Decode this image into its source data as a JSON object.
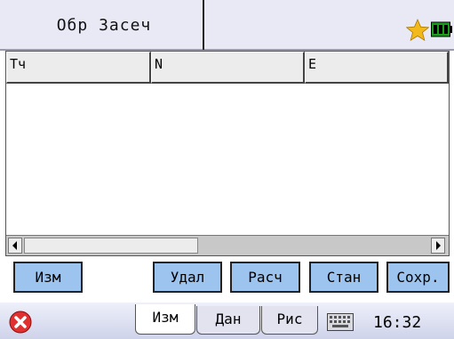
{
  "titlebar": {
    "title": "Обр Засеч",
    "icons": [
      "star-icon",
      "battery-icon"
    ],
    "colors": {
      "background": "#e9e9f6",
      "star": "#f3b81a",
      "battery": "#1c9c1c"
    }
  },
  "grid": {
    "columns": [
      "Тч",
      "N",
      "E"
    ],
    "rows": []
  },
  "buttons": {
    "measure": "Изм",
    "delete": "Удал",
    "calc": "Расч",
    "station": "Стан",
    "save": "Сохр.",
    "color": "#9cc4ef"
  },
  "bottom": {
    "tabs": [
      "Изм",
      "Дан",
      "Рис"
    ],
    "active_tab": "Изм",
    "time": "16:32",
    "icons": [
      "close-icon",
      "keyboard-icon"
    ]
  }
}
